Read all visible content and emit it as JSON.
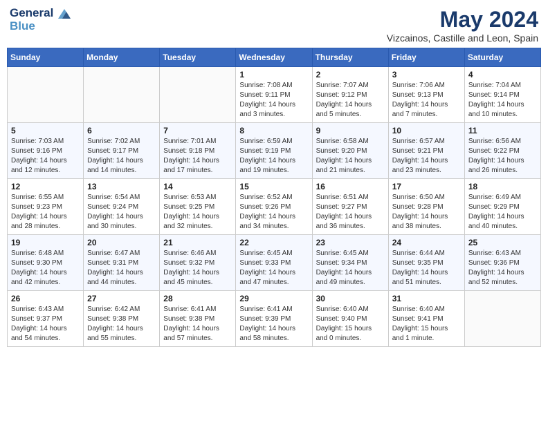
{
  "header": {
    "logo_line1": "General",
    "logo_line2": "Blue",
    "month_title": "May 2024",
    "subtitle": "Vizcainos, Castille and Leon, Spain"
  },
  "days_of_week": [
    "Sunday",
    "Monday",
    "Tuesday",
    "Wednesday",
    "Thursday",
    "Friday",
    "Saturday"
  ],
  "weeks": [
    [
      {
        "day": "",
        "info": ""
      },
      {
        "day": "",
        "info": ""
      },
      {
        "day": "",
        "info": ""
      },
      {
        "day": "1",
        "info": "Sunrise: 7:08 AM\nSunset: 9:11 PM\nDaylight: 14 hours\nand 3 minutes."
      },
      {
        "day": "2",
        "info": "Sunrise: 7:07 AM\nSunset: 9:12 PM\nDaylight: 14 hours\nand 5 minutes."
      },
      {
        "day": "3",
        "info": "Sunrise: 7:06 AM\nSunset: 9:13 PM\nDaylight: 14 hours\nand 7 minutes."
      },
      {
        "day": "4",
        "info": "Sunrise: 7:04 AM\nSunset: 9:14 PM\nDaylight: 14 hours\nand 10 minutes."
      }
    ],
    [
      {
        "day": "5",
        "info": "Sunrise: 7:03 AM\nSunset: 9:16 PM\nDaylight: 14 hours\nand 12 minutes."
      },
      {
        "day": "6",
        "info": "Sunrise: 7:02 AM\nSunset: 9:17 PM\nDaylight: 14 hours\nand 14 minutes."
      },
      {
        "day": "7",
        "info": "Sunrise: 7:01 AM\nSunset: 9:18 PM\nDaylight: 14 hours\nand 17 minutes."
      },
      {
        "day": "8",
        "info": "Sunrise: 6:59 AM\nSunset: 9:19 PM\nDaylight: 14 hours\nand 19 minutes."
      },
      {
        "day": "9",
        "info": "Sunrise: 6:58 AM\nSunset: 9:20 PM\nDaylight: 14 hours\nand 21 minutes."
      },
      {
        "day": "10",
        "info": "Sunrise: 6:57 AM\nSunset: 9:21 PM\nDaylight: 14 hours\nand 23 minutes."
      },
      {
        "day": "11",
        "info": "Sunrise: 6:56 AM\nSunset: 9:22 PM\nDaylight: 14 hours\nand 26 minutes."
      }
    ],
    [
      {
        "day": "12",
        "info": "Sunrise: 6:55 AM\nSunset: 9:23 PM\nDaylight: 14 hours\nand 28 minutes."
      },
      {
        "day": "13",
        "info": "Sunrise: 6:54 AM\nSunset: 9:24 PM\nDaylight: 14 hours\nand 30 minutes."
      },
      {
        "day": "14",
        "info": "Sunrise: 6:53 AM\nSunset: 9:25 PM\nDaylight: 14 hours\nand 32 minutes."
      },
      {
        "day": "15",
        "info": "Sunrise: 6:52 AM\nSunset: 9:26 PM\nDaylight: 14 hours\nand 34 minutes."
      },
      {
        "day": "16",
        "info": "Sunrise: 6:51 AM\nSunset: 9:27 PM\nDaylight: 14 hours\nand 36 minutes."
      },
      {
        "day": "17",
        "info": "Sunrise: 6:50 AM\nSunset: 9:28 PM\nDaylight: 14 hours\nand 38 minutes."
      },
      {
        "day": "18",
        "info": "Sunrise: 6:49 AM\nSunset: 9:29 PM\nDaylight: 14 hours\nand 40 minutes."
      }
    ],
    [
      {
        "day": "19",
        "info": "Sunrise: 6:48 AM\nSunset: 9:30 PM\nDaylight: 14 hours\nand 42 minutes."
      },
      {
        "day": "20",
        "info": "Sunrise: 6:47 AM\nSunset: 9:31 PM\nDaylight: 14 hours\nand 44 minutes."
      },
      {
        "day": "21",
        "info": "Sunrise: 6:46 AM\nSunset: 9:32 PM\nDaylight: 14 hours\nand 45 minutes."
      },
      {
        "day": "22",
        "info": "Sunrise: 6:45 AM\nSunset: 9:33 PM\nDaylight: 14 hours\nand 47 minutes."
      },
      {
        "day": "23",
        "info": "Sunrise: 6:45 AM\nSunset: 9:34 PM\nDaylight: 14 hours\nand 49 minutes."
      },
      {
        "day": "24",
        "info": "Sunrise: 6:44 AM\nSunset: 9:35 PM\nDaylight: 14 hours\nand 51 minutes."
      },
      {
        "day": "25",
        "info": "Sunrise: 6:43 AM\nSunset: 9:36 PM\nDaylight: 14 hours\nand 52 minutes."
      }
    ],
    [
      {
        "day": "26",
        "info": "Sunrise: 6:43 AM\nSunset: 9:37 PM\nDaylight: 14 hours\nand 54 minutes."
      },
      {
        "day": "27",
        "info": "Sunrise: 6:42 AM\nSunset: 9:38 PM\nDaylight: 14 hours\nand 55 minutes."
      },
      {
        "day": "28",
        "info": "Sunrise: 6:41 AM\nSunset: 9:38 PM\nDaylight: 14 hours\nand 57 minutes."
      },
      {
        "day": "29",
        "info": "Sunrise: 6:41 AM\nSunset: 9:39 PM\nDaylight: 14 hours\nand 58 minutes."
      },
      {
        "day": "30",
        "info": "Sunrise: 6:40 AM\nSunset: 9:40 PM\nDaylight: 15 hours\nand 0 minutes."
      },
      {
        "day": "31",
        "info": "Sunrise: 6:40 AM\nSunset: 9:41 PM\nDaylight: 15 hours\nand 1 minute."
      },
      {
        "day": "",
        "info": ""
      }
    ]
  ]
}
